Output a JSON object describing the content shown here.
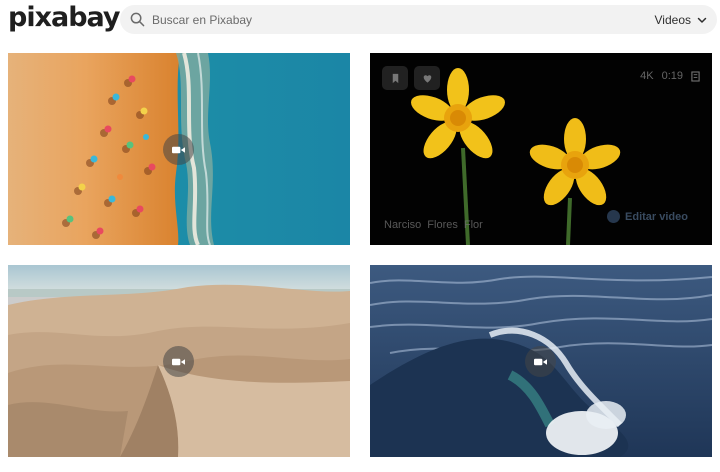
{
  "header": {
    "logo": "pixabay",
    "search": {
      "placeholder": "Buscar en Pixabay",
      "icon": "search-icon"
    },
    "type_select": {
      "value": "Videos",
      "icon": "chevron-down-icon"
    }
  },
  "tiles": [
    {
      "subject": "beach-aerial",
      "badge_icon": "video-camera-icon"
    },
    {
      "subject": "yellow-daffodils",
      "overlay": {
        "actions": [
          {
            "icon": "bookmark-icon"
          },
          {
            "icon": "heart-icon"
          }
        ],
        "quality": "4K",
        "duration": "0:19",
        "tags": [
          "Narciso",
          "Flores",
          "Flor"
        ],
        "edit_label": "Editar video"
      }
    },
    {
      "subject": "desert-dunes",
      "badge_icon": "video-camera-icon"
    },
    {
      "subject": "ocean-waves",
      "badge_icon": "video-camera-icon"
    }
  ],
  "colors": {
    "search_bg": "#f2f2f2",
    "badge_bg": "rgba(70,70,70,0.55)",
    "sand": "#e8a664",
    "sea": "#1d8fa8",
    "daffodil": "#f2c21a",
    "dune": "#c9a988",
    "wave": "#2d4a6e"
  }
}
